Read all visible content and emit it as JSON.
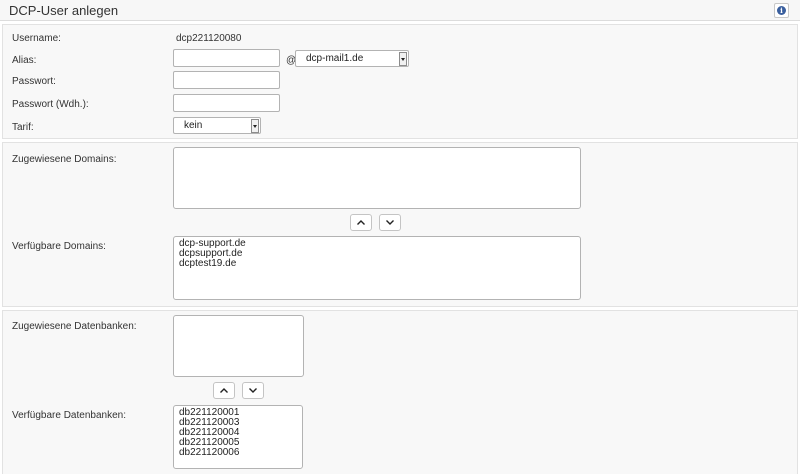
{
  "header": {
    "title": "DCP-User anlegen",
    "info_icon": "info-circle-icon"
  },
  "form": {
    "username_label": "Username:",
    "username_value": "dcp221120080",
    "alias_label": "Alias:",
    "alias_value": "",
    "at_sign": "@",
    "mail_domain_selected": "dcp-mail1.de",
    "password_label": "Passwort:",
    "password_repeat_label": "Passwort (Wdh.):",
    "tariff_label": "Tarif:",
    "tariff_selected": "kein"
  },
  "domains": {
    "assigned_label": "Zugewiesene Domains:",
    "assigned_items": [],
    "available_label": "Verfügbare Domains:",
    "available_items": [
      "dcp-support.de",
      "dcpsupport.de",
      "dcptest19.de"
    ]
  },
  "databases": {
    "assigned_label": "Zugewiesene Datenbanken:",
    "assigned_items": [],
    "available_label": "Verfügbare Datenbanken:",
    "available_items": [
      "db221120001",
      "db221120003",
      "db221120004",
      "db221120005",
      "db221120006"
    ]
  },
  "icons": {
    "move_up": "chevron-up-icon",
    "move_down": "chevron-down-icon",
    "select_arrow": "chevron-down-icon"
  },
  "colors": {
    "panel_background": "#f8f8f8",
    "border": "#b3b3b3",
    "info_icon": "#3a5f9e",
    "text": "#333333"
  }
}
